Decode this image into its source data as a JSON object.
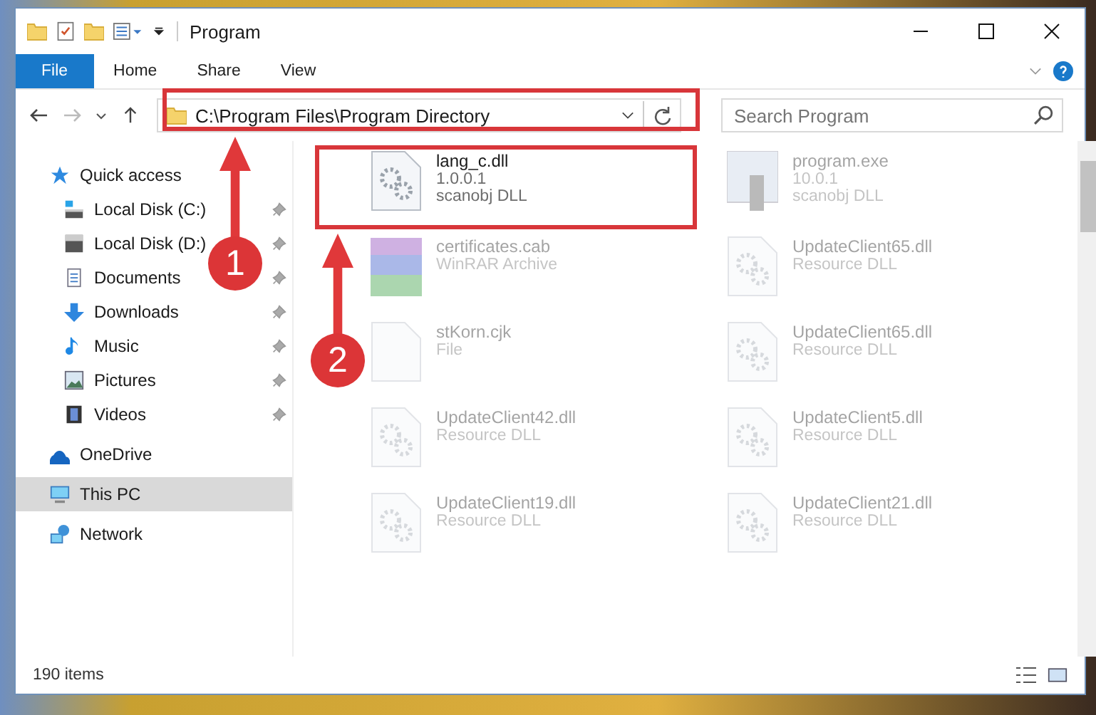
{
  "window": {
    "title": "Program"
  },
  "ribbon_tabs": [
    {
      "label": "File",
      "selected": true
    },
    {
      "label": "Home",
      "selected": false
    },
    {
      "label": "Share",
      "selected": false
    },
    {
      "label": "View",
      "selected": false
    }
  ],
  "address_bar": {
    "path": "C:\\Program Files\\Program Directory"
  },
  "search": {
    "placeholder": "Search Program"
  },
  "sidebar": {
    "items": [
      {
        "label": "Quick access",
        "selected": false,
        "children": [
          {
            "label": "Local Disk (C:)",
            "pinned": true
          },
          {
            "label": "Local Disk (D:)",
            "pinned": true
          },
          {
            "label": "Documents",
            "pinned": true
          },
          {
            "label": "Downloads",
            "pinned": true
          },
          {
            "label": "Music",
            "pinned": true
          },
          {
            "label": "Pictures",
            "pinned": true
          },
          {
            "label": "Videos",
            "pinned": true
          }
        ]
      },
      {
        "label": "OneDrive",
        "selected": false
      },
      {
        "label": "This PC",
        "selected": true
      },
      {
        "label": "Network",
        "selected": false
      }
    ]
  },
  "files": [
    {
      "name": "lang_c.dll",
      "lines": [
        "1.0.0.1",
        "scanobj DLL"
      ],
      "kind": "dll",
      "blurred": false
    },
    {
      "name": "program.exe",
      "lines": [
        "10.0.1",
        "scanobj DLL"
      ],
      "kind": "exe",
      "blurred": true
    },
    {
      "name": "certificates.cab",
      "lines": [
        "WinRAR Archive"
      ],
      "kind": "archive",
      "blurred": true
    },
    {
      "name": "UpdateClient65.dll",
      "lines": [
        "Resource DLL"
      ],
      "kind": "dll",
      "blurred": true
    },
    {
      "name": "stKorn.cjk",
      "lines": [
        "File"
      ],
      "kind": "file",
      "blurred": true
    },
    {
      "name": "UpdateClient65.dll",
      "lines": [
        "Resource DLL"
      ],
      "kind": "dll",
      "blurred": true
    },
    {
      "name": "UpdateClient42.dll",
      "lines": [
        "Resource DLL"
      ],
      "kind": "dll",
      "blurred": true
    },
    {
      "name": "UpdateClient5.dll",
      "lines": [
        "Resource DLL"
      ],
      "kind": "dll",
      "blurred": true
    },
    {
      "name": "UpdateClient19.dll",
      "lines": [
        "Resource DLL"
      ],
      "kind": "dll",
      "blurred": true
    },
    {
      "name": "UpdateClient21.dll",
      "lines": [
        "Resource DLL"
      ],
      "kind": "dll",
      "blurred": true
    }
  ],
  "status_bar": {
    "count": "190 items"
  },
  "annotations": [
    {
      "number": "1"
    },
    {
      "number": "2"
    }
  ]
}
